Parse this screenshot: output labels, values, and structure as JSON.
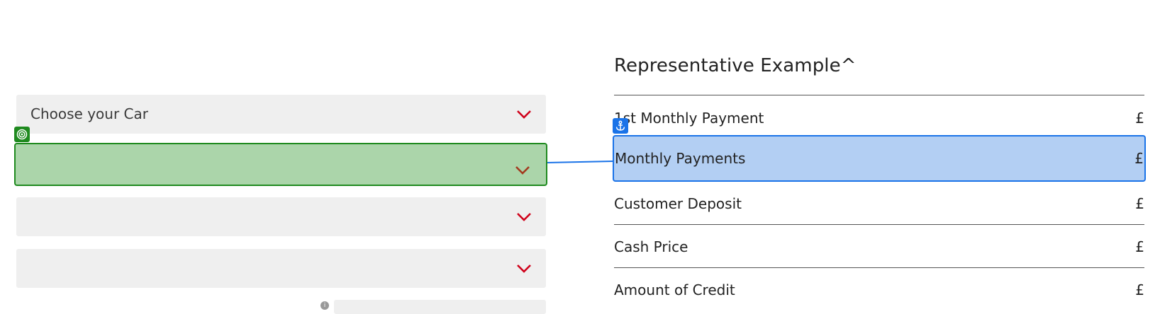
{
  "form": {
    "car_select_label": "Choose your Car",
    "info_icon": "i"
  },
  "summary": {
    "heading": "Representative Example^",
    "rows": [
      {
        "label": "1st Monthly Payment",
        "value": "£"
      },
      {
        "label": "Monthly Payments",
        "value": "£"
      },
      {
        "label": "Customer Deposit",
        "value": "£"
      },
      {
        "label": "Cash Price",
        "value": "£"
      },
      {
        "label": "Amount of Credit",
        "value": "£"
      }
    ]
  },
  "colors": {
    "chevron": "#d0021b",
    "select_bg": "#efefef",
    "highlight_green": "#abd5aa",
    "highlight_blue": "#b3cff3",
    "badge_green": "#1f8a1f",
    "badge_blue": "#1a73e8"
  },
  "icons": {
    "target_badge": "target-icon",
    "anchor_badge": "anchor-icon",
    "chevron": "chevron-down-icon"
  }
}
